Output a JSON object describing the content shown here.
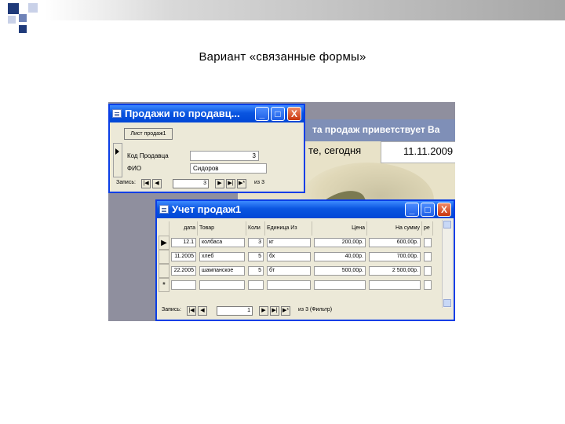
{
  "slide": {
    "title": "Вариант «связанные формы»",
    "colors": {
      "sq_dark": "#1f3a7a",
      "sq_mid": "#6f83b8",
      "sq_light": "#c9d1e8"
    }
  },
  "background_window": {
    "header_text": "та продаж приветствует Ва",
    "greeting": "те, сегодня",
    "date": "11.11.2009"
  },
  "form1": {
    "title": "Продажи по продавц...",
    "button_label": "Лист продаж1",
    "fields": [
      {
        "label": "Код Продавца",
        "value": "3"
      },
      {
        "label": "ФИО",
        "value": "Сидоров"
      }
    ],
    "nav": {
      "label": "Запись:",
      "current": "3",
      "of": "из 3"
    },
    "title_buttons": {
      "minimize": "_",
      "maximize": "□",
      "close": "X"
    }
  },
  "form2": {
    "title": "Учет продаж1",
    "title_buttons": {
      "minimize": "_",
      "maximize": "□",
      "close": "X"
    },
    "columns": [
      "дата",
      "Товар",
      "Коли",
      "Единица Из",
      "Цена",
      "На сумму",
      "ре"
    ],
    "rows": [
      [
        "12.1",
        "колбаса",
        "3",
        "кг",
        "200,00р.",
        "600,00р."
      ],
      [
        "11.2005",
        "хлеб",
        "5",
        "бх",
        "40,00р.",
        "700,00р."
      ],
      [
        "22.2005",
        "шампанское",
        "5",
        "бт",
        "500,00р.",
        "2 500,00р."
      ]
    ],
    "new_row_marker": "*",
    "nav": {
      "label": "Запись:",
      "current": "1",
      "of": "из 3 (Фильтр)"
    }
  }
}
